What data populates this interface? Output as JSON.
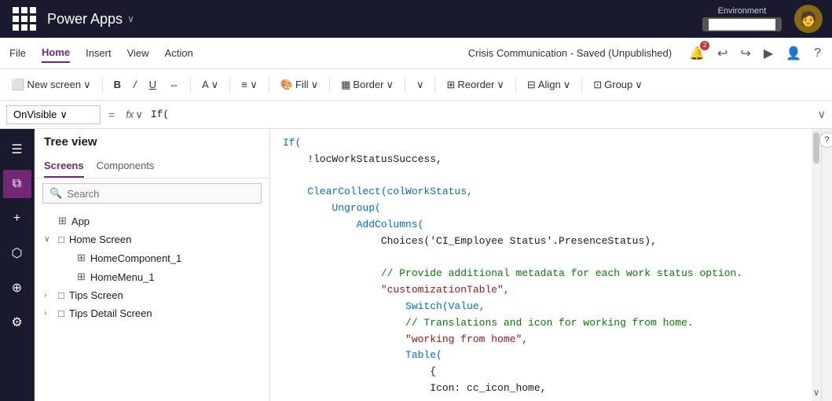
{
  "topBar": {
    "appTitle": "Power Apps",
    "chevron": "∨",
    "env": {
      "label": "Environment",
      "value": "─────────────"
    }
  },
  "menuBar": {
    "items": [
      "File",
      "Home",
      "Insert",
      "View",
      "Action"
    ],
    "activeItem": "Home",
    "docTitle": "Crisis Communication - Saved (Unpublished)",
    "icons": {
      "notification": "🔔",
      "undo": "↩",
      "redo": "↪",
      "play": "▶",
      "user": "👤",
      "help": "?"
    }
  },
  "toolbar": {
    "newScreen": "New screen",
    "bold": "B",
    "italic": "/",
    "underline": "U",
    "align": "⇔",
    "font": "A",
    "textAlign": "≡",
    "fill": "Fill",
    "border": "Border",
    "chevronDown": "∨",
    "reorder": "Reorder",
    "align2": "Align",
    "group": "Group"
  },
  "formulaBar": {
    "selector": "OnVisible",
    "eq": "=",
    "fx": "fx",
    "formula": "If(",
    "expandIcon": "∨"
  },
  "sidebar": {
    "title": "Tree view",
    "tabs": [
      "Screens",
      "Components"
    ],
    "activeTab": "Screens",
    "searchPlaceholder": "Search",
    "items": [
      {
        "id": "app",
        "label": "App",
        "icon": "⊞",
        "indent": 0,
        "hasChevron": false
      },
      {
        "id": "home-screen",
        "label": "Home Screen",
        "icon": "□",
        "indent": 0,
        "hasChevron": true,
        "expanded": true
      },
      {
        "id": "home-component",
        "label": "HomeComponent_1",
        "icon": "⊞",
        "indent": 1,
        "hasChevron": false
      },
      {
        "id": "home-menu",
        "label": "HomeMenu_1",
        "icon": "⊞",
        "indent": 1,
        "hasChevron": false
      },
      {
        "id": "tips-screen",
        "label": "Tips Screen",
        "icon": "□",
        "indent": 0,
        "hasChevron": true,
        "expanded": false
      },
      {
        "id": "tips-detail",
        "label": "Tips Detail Screen",
        "icon": "□",
        "indent": 0,
        "hasChevron": true,
        "expanded": false
      }
    ]
  },
  "sideIcons": [
    {
      "id": "hamburger",
      "icon": "☰",
      "active": false
    },
    {
      "id": "layers",
      "icon": "⧉",
      "active": true
    },
    {
      "id": "plus",
      "icon": "+",
      "active": false
    },
    {
      "id": "shapes",
      "icon": "⬡",
      "active": false
    },
    {
      "id": "data",
      "icon": "⊕",
      "active": false
    },
    {
      "id": "settings",
      "icon": "⚙",
      "active": false
    }
  ],
  "code": {
    "lines": [
      {
        "type": "mixed",
        "parts": [
          {
            "text": "If(",
            "cls": "c-keyword"
          }
        ]
      },
      {
        "type": "mixed",
        "parts": [
          {
            "text": "    !locWorkStatusSuccess,",
            "cls": "c-default"
          }
        ]
      },
      {
        "type": "blank",
        "parts": []
      },
      {
        "type": "mixed",
        "parts": [
          {
            "text": "    ClearCollect(colWorkStatus,",
            "cls": "c-keyword"
          }
        ]
      },
      {
        "type": "mixed",
        "parts": [
          {
            "text": "        Ungroup(",
            "cls": "c-keyword"
          }
        ]
      },
      {
        "type": "mixed",
        "parts": [
          {
            "text": "            AddColumns(",
            "cls": "c-keyword"
          }
        ]
      },
      {
        "type": "mixed",
        "parts": [
          {
            "text": "                Choices('CI_Employee Status'.PresenceStatus),",
            "cls": "c-default"
          }
        ]
      },
      {
        "type": "blank",
        "parts": []
      },
      {
        "type": "mixed",
        "parts": [
          {
            "text": "                // Provide additional metadata for each work status option.",
            "cls": "c-comment"
          }
        ]
      },
      {
        "type": "mixed",
        "parts": [
          {
            "text": "                \"customizationTable\",",
            "cls": "c-string"
          }
        ]
      },
      {
        "type": "mixed",
        "parts": [
          {
            "text": "                    Switch(Value,",
            "cls": "c-keyword"
          }
        ]
      },
      {
        "type": "mixed",
        "parts": [
          {
            "text": "                    // Translations and icon for working from home.",
            "cls": "c-comment"
          }
        ]
      },
      {
        "type": "mixed",
        "parts": [
          {
            "text": "                    \"working from home\",",
            "cls": "c-string"
          }
        ]
      },
      {
        "type": "mixed",
        "parts": [
          {
            "text": "                    Table(",
            "cls": "c-keyword"
          }
        ]
      },
      {
        "type": "mixed",
        "parts": [
          {
            "text": "                        {",
            "cls": "c-default"
          }
        ]
      },
      {
        "type": "mixed",
        "parts": [
          {
            "text": "                        Icon: cc_icon_home,",
            "cls": "c-default"
          }
        ]
      }
    ]
  },
  "help": "?"
}
